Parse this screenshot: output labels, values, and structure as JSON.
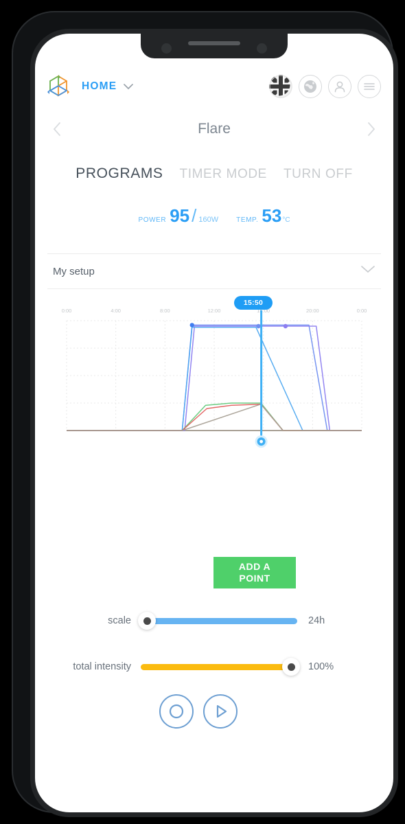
{
  "device": {
    "frame": "smartphone",
    "notch": true
  },
  "header": {
    "logo_icon": "cube-logo-icon",
    "home_label": "HOME",
    "home_chevron_icon": "chevron-down-icon",
    "icons": [
      {
        "name": "language-flag-icon",
        "label": "UK"
      },
      {
        "name": "globe-icon",
        "label": "Globe"
      },
      {
        "name": "user-icon",
        "label": "Account"
      },
      {
        "name": "hamburger-menu-icon",
        "label": "Menu"
      }
    ]
  },
  "titlebar": {
    "prev_icon": "chevron-left-icon",
    "title": "Flare",
    "next_icon": "chevron-right-icon"
  },
  "tabs": [
    {
      "label": "PROGRAMS",
      "active": true
    },
    {
      "label": "TIMER MODE",
      "active": false
    },
    {
      "label": "TURN OFF",
      "active": false
    }
  ],
  "readouts": {
    "power_label": "POWER",
    "power_value": "95",
    "power_separator": "/",
    "power_max": "160W",
    "temp_label": "TEMP.",
    "temp_value": "53",
    "temp_unit": "°C"
  },
  "setup": {
    "label": "My setup",
    "chevron_icon": "chevron-down-icon"
  },
  "chart_data": {
    "type": "line",
    "title": "",
    "xlabel": "",
    "ylabel": "",
    "grid": true,
    "legend_position": "none",
    "selected_time": "15:50",
    "selected_x": 15.83,
    "xlim": [
      0,
      24
    ],
    "ylim": [
      0,
      100
    ],
    "tick_labels": [
      "0:00",
      "4:00",
      "8:00",
      "12:00",
      "16:00",
      "20:00",
      "0:00"
    ],
    "tick_values": [
      0,
      4,
      8,
      12,
      16,
      20,
      24
    ],
    "series": [
      {
        "name": "channel-blue-primary",
        "color": "#6f8ef0",
        "x": [
          0,
          9.4,
          10.2,
          16.0,
          19.7,
          21.2,
          24
        ],
        "y": [
          0,
          0,
          96,
          96,
          96,
          0,
          0
        ]
      },
      {
        "name": "channel-violet",
        "color": "#8d7ef0",
        "x": [
          0,
          9.6,
          10.4,
          16.2,
          20.3,
          21.4,
          24
        ],
        "y": [
          0,
          0,
          95,
          95,
          95,
          0,
          0
        ]
      },
      {
        "name": "channel-cyan",
        "color": "#4ea8f0",
        "x": [
          0,
          9.4,
          10.2,
          15.4,
          19.2,
          24
        ],
        "y": [
          0,
          0,
          94,
          94,
          0,
          0
        ]
      },
      {
        "name": "channel-green",
        "color": "#63c97b",
        "x": [
          0,
          9.4,
          11.3,
          13.4,
          15.8,
          17.6,
          24
        ],
        "y": [
          0,
          0,
          23,
          25,
          25,
          0,
          0
        ]
      },
      {
        "name": "channel-red",
        "color": "#e0605f",
        "x": [
          0,
          9.4,
          11.4,
          13.4,
          15.8,
          17.6,
          24
        ],
        "y": [
          0,
          0,
          20,
          23,
          24,
          0,
          0
        ]
      },
      {
        "name": "channel-warm-white",
        "color": "#a8a095",
        "x": [
          0,
          9.4,
          15.8,
          17.6,
          24
        ],
        "y": [
          0,
          0,
          24,
          0,
          0
        ]
      }
    ],
    "points": [
      {
        "x": 10.2,
        "y": 96,
        "color": "#3f7df0"
      },
      {
        "x": 15.6,
        "y": 95,
        "color": "#6f8ef0"
      },
      {
        "x": 17.8,
        "y": 95,
        "color": "#8d7ef0"
      }
    ],
    "cursor": {
      "x": 15.83,
      "color": "#3fb0f5",
      "handle_icon": "time-cursor-handle-icon"
    }
  },
  "add_point": {
    "label_line1": "ADD A",
    "label_line2": "POINT",
    "color": "#4fd06a"
  },
  "sliders": [
    {
      "name": "scale",
      "label": "scale",
      "value": "24h",
      "fill_color": "#67b4f2",
      "knob_position": "left"
    },
    {
      "name": "total-intensity",
      "label": "total intensity",
      "value": "100%",
      "fill_color": "#fbbb10",
      "knob_position": "right"
    }
  ],
  "transport": [
    {
      "name": "record-button",
      "icon": "record-circle-icon"
    },
    {
      "name": "play-button",
      "icon": "play-triangle-icon"
    }
  ],
  "colors": {
    "accent_blue": "#2b9ef5",
    "green": "#4fd06a",
    "amber": "#fbbb10",
    "text_gray": "#67707a"
  }
}
